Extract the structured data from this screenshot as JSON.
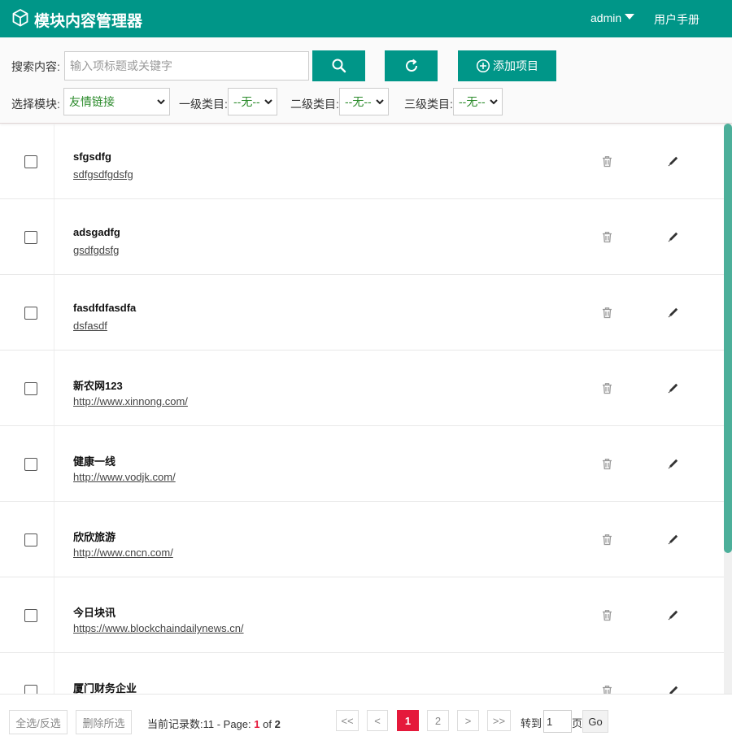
{
  "header": {
    "title": "模块内容管理器",
    "user": "admin",
    "manual": "用户手册"
  },
  "toolbar": {
    "search_label": "搜索内容:",
    "search_placeholder": "输入项标题或关键字",
    "add_label": "添加项目",
    "module_label": "选择模块:",
    "module_value": "友情链接",
    "level1_label": "一级类目:",
    "level1_value": "--无--",
    "level2_label": "二级类目:",
    "level2_value": "--无--",
    "level3_label": "三级类目:",
    "level3_value": "--无--"
  },
  "items": [
    {
      "name": "sfgsdfg",
      "url": "sdfgsdfgdsfg"
    },
    {
      "name": "adsgadfg",
      "url": "gsdfgdsfg"
    },
    {
      "name": "fasdfdfasdfa",
      "url": "dsfasdf"
    },
    {
      "name": "新农网123",
      "url": "http://www.xinnong.com/"
    },
    {
      "name": "健康一线",
      "url": "http://www.vodjk.com/"
    },
    {
      "name": "欣欣旅游",
      "url": "http://www.cncn.com/"
    },
    {
      "name": "今日块讯",
      "url": "https://www.blockchaindailynews.cn/"
    },
    {
      "name": "厦门财务企业",
      "url": ""
    }
  ],
  "footer": {
    "select_all": "全选/反选",
    "delete_selected": "删除所选",
    "records_prefix": "当前记录数:11 - Page: ",
    "current_page": "1",
    "of_text": " of ",
    "total_pages": "2",
    "first": "<<",
    "prev": "<",
    "page1": "1",
    "page2": "2",
    "next": ">",
    "last": ">>",
    "goto_label": "转到",
    "goto_value": "1",
    "page_unit": "页",
    "go": "Go"
  },
  "colors": {
    "brand": "#009688",
    "active_page": "#e5193b",
    "scroll_thumb": "#4caf9a"
  },
  "icons": {
    "logo": "cube-icon",
    "search": "search-icon",
    "refresh": "refresh-icon",
    "add": "plus-circle-icon",
    "delete": "trash-icon",
    "edit": "pencil-icon"
  }
}
